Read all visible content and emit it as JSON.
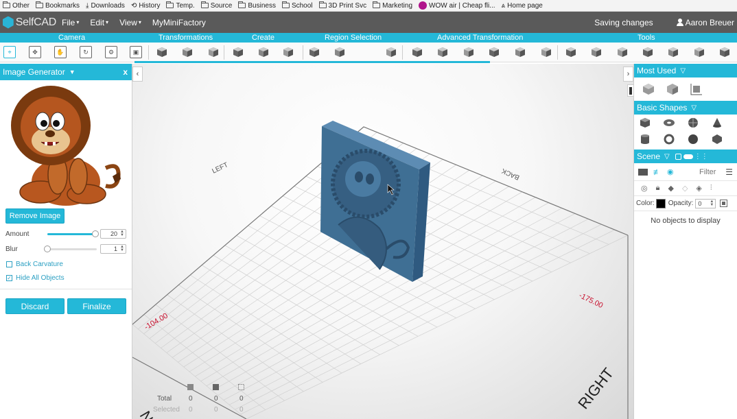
{
  "bookmarks": [
    {
      "label": "Other",
      "icon": "folder-icon"
    },
    {
      "label": "Bookmarks",
      "icon": "folder-icon"
    },
    {
      "label": "Downloads",
      "icon": "download-icon"
    },
    {
      "label": "History",
      "icon": "history-icon"
    },
    {
      "label": "Temp.",
      "icon": "folder-icon"
    },
    {
      "label": "Source",
      "icon": "folder-icon"
    },
    {
      "label": "Business",
      "icon": "folder-icon"
    },
    {
      "label": "School",
      "icon": "folder-icon"
    },
    {
      "label": "3D Print Svc",
      "icon": "folder-icon"
    },
    {
      "label": "Marketing",
      "icon": "folder-icon"
    },
    {
      "label": "WOW air | Cheap fli...",
      "icon": "wow-icon"
    },
    {
      "label": "Home page",
      "icon": "page-icon"
    }
  ],
  "app": {
    "logo": "SelfCAD",
    "menus": [
      "File",
      "Edit",
      "View"
    ],
    "project": "MyMiniFactory",
    "status": "Saving changes",
    "user": "Aaron Breuer"
  },
  "groups": {
    "camera": "Camera",
    "transformations": "Transformations",
    "create": "Create",
    "region_selection": "Region Selection",
    "advanced_transformation": "Advanced Transformation",
    "tools": "Tools"
  },
  "colors": {
    "accent": "#24b8d8",
    "menubar": "#5a5a5a",
    "model": "#3f6f94",
    "axis_label": "#c8102e"
  },
  "image_generator": {
    "title": "Image Generator",
    "close": "x",
    "remove_label": "Remove Image",
    "amount_label": "Amount",
    "amount_value": "20",
    "amount_fraction": 0.97,
    "blur_label": "Blur",
    "blur_value": "1",
    "blur_fraction": 0.0,
    "back_curvature_label": "Back Carvature",
    "back_curvature_checked": false,
    "hide_all_label": "Hide All Objects",
    "hide_all_checked": true,
    "discard_label": "Discard",
    "finalize_label": "Finalize"
  },
  "viewport": {
    "axis_left": "LEFT",
    "axis_back": "BACK",
    "axis_right": "RIGHT",
    "axis_front": "NT",
    "value_left": "-104.00",
    "value_right": "-175.00",
    "stats": {
      "total_label": "Total",
      "selected_label": "Selected",
      "total": [
        "0",
        "0",
        "0"
      ],
      "selected": [
        "0",
        "0",
        "0"
      ]
    }
  },
  "right_panel": {
    "most_used": "Most Used",
    "basic_shapes": "Basic Shapes",
    "scene": "Scene",
    "filter_placeholder": "Filter",
    "color_label": "Color:",
    "opacity_label": "Opacity:",
    "opacity_value": "0",
    "empty_message": "No objects to display"
  }
}
